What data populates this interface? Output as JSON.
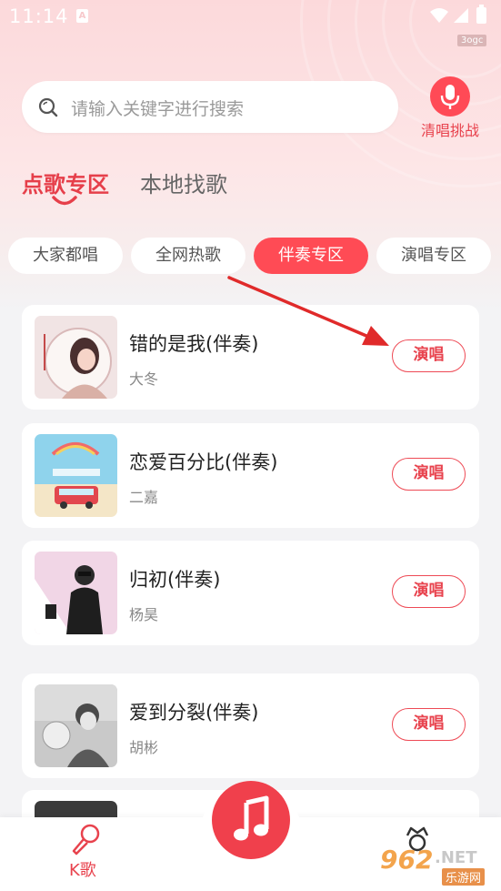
{
  "status_bar": {
    "time": "11:14",
    "notification_letter": "A"
  },
  "watermark_top": "3ogc",
  "search": {
    "placeholder": "请输入关键字进行搜索"
  },
  "challenge_button": {
    "label": "清唱挑战"
  },
  "main_tabs": [
    {
      "label": "点歌专区",
      "active": true
    },
    {
      "label": "本地找歌",
      "active": false
    }
  ],
  "category_chips": [
    {
      "label": "大家都唱",
      "active": false
    },
    {
      "label": "全网热歌",
      "active": false
    },
    {
      "label": "伴奏专区",
      "active": true
    },
    {
      "label": "演唱专区",
      "active": false
    }
  ],
  "songs": [
    {
      "title": "错的是我(伴奏)",
      "artist": "大冬",
      "action": "演唱"
    },
    {
      "title": "恋爱百分比(伴奏)",
      "artist": "二嘉",
      "action": "演唱"
    },
    {
      "title": "归初(伴奏)",
      "artist": "杨昊",
      "action": "演唱"
    },
    {
      "title": "爱到分裂(伴奏)",
      "artist": "胡彬",
      "action": "演唱"
    }
  ],
  "bottom_nav": {
    "k_song_label": "K歌"
  },
  "watermark_bottom": {
    "brand": "962",
    "net": ".NET",
    "sub": "乐游网"
  },
  "colors": {
    "accent": "#e63f4a",
    "button": "#ff4b55",
    "arrow": "#e02a2a"
  }
}
